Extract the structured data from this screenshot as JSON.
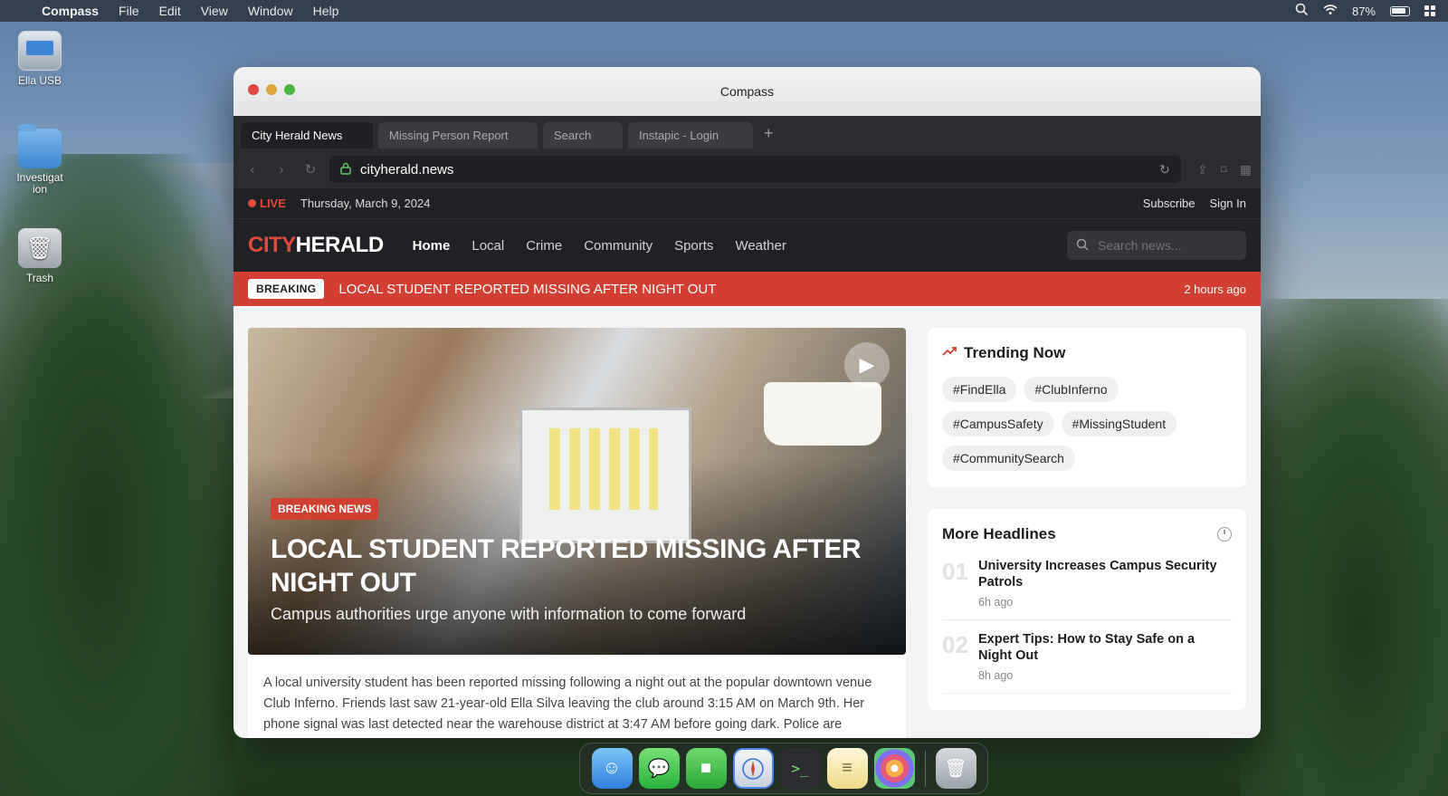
{
  "menubar": {
    "app_name": "Compass",
    "items": [
      "File",
      "Edit",
      "View",
      "Window",
      "Help"
    ],
    "battery": "87%"
  },
  "desktop": {
    "icons": [
      {
        "label": "Ella USB",
        "icon": "usb-drive-icon"
      },
      {
        "label": "Investigat ion",
        "icon": "folder-icon"
      },
      {
        "label": "Trash",
        "icon": "trash-icon"
      }
    ]
  },
  "window": {
    "title": "Compass",
    "tabs": [
      {
        "label": "City Herald News",
        "active": true
      },
      {
        "label": "Missing Person Report",
        "active": false
      },
      {
        "label": "Search",
        "active": false
      },
      {
        "label": "Instapic - Login",
        "active": false
      }
    ],
    "url": "cityherald.news"
  },
  "site": {
    "live_label": "LIVE",
    "date": "Thursday, March 9, 2024",
    "top_links": [
      "Subscribe",
      "Sign In"
    ],
    "logo_city": "CITY",
    "logo_herald": "HERALD",
    "nav": [
      "Home",
      "Local",
      "Crime",
      "Community",
      "Sports",
      "Weather"
    ],
    "search_placeholder": "Search news...",
    "breaking": {
      "tag": "BREAKING",
      "text": "LOCAL STUDENT REPORTED MISSING AFTER NIGHT OUT",
      "time": "2 hours ago"
    },
    "hero": {
      "tag": "BREAKING NEWS",
      "title": "LOCAL STUDENT REPORTED MISSING AFTER NIGHT OUT",
      "subtitle": "Campus authorities urge anyone with information to come forward"
    },
    "article_text": "A local university student has been reported missing following a night out at the popular downtown venue Club Inferno. Friends last saw 21-year-old Ella Silva leaving the club around 3:15 AM on March 9th. Her phone signal was last detected near the warehouse district at 3:47 AM before going dark. Police are",
    "trending": {
      "title": "Trending Now",
      "tags": [
        "#FindElla",
        "#ClubInferno",
        "#CampusSafety",
        "#MissingStudent",
        "#CommunitySearch"
      ]
    },
    "more_headlines": {
      "title": "More Headlines",
      "items": [
        {
          "num": "01",
          "title": "University Increases Campus Security Patrols",
          "time": "6h ago"
        },
        {
          "num": "02",
          "title": "Expert Tips: How to Stay Safe on a Night Out",
          "time": "8h ago"
        }
      ]
    }
  },
  "dock": {
    "items": [
      "finder-icon",
      "messages-icon",
      "facetime-icon",
      "compass-icon",
      "terminal-icon",
      "notes-icon",
      "photos-icon",
      "trash-icon"
    ]
  }
}
